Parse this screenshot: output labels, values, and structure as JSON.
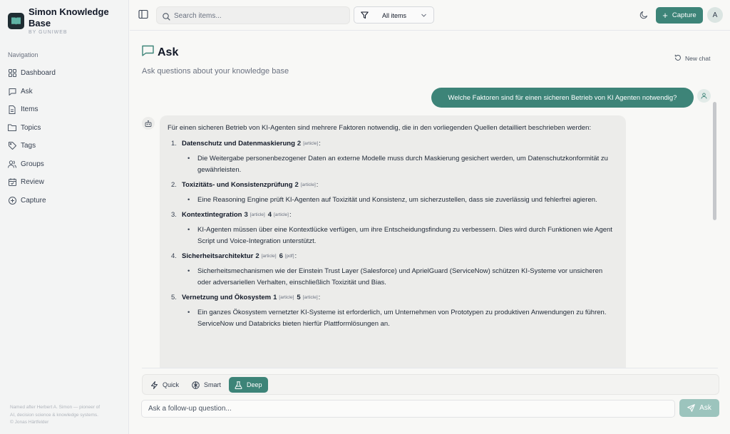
{
  "brand": {
    "title": "Simon Knowledge Base",
    "subtitle": "BY GUNIWEB"
  },
  "sidebar": {
    "heading": "Navigation",
    "items": [
      {
        "label": "Dashboard",
        "icon": "grid-icon"
      },
      {
        "label": "Ask",
        "icon": "chat-icon"
      },
      {
        "label": "Items",
        "icon": "file-icon"
      },
      {
        "label": "Topics",
        "icon": "folder-icon"
      },
      {
        "label": "Tags",
        "icon": "tag-icon"
      },
      {
        "label": "Groups",
        "icon": "users-icon"
      },
      {
        "label": "Review",
        "icon": "calendar-icon"
      },
      {
        "label": "Capture",
        "icon": "plus-circle-icon"
      }
    ],
    "footer_lines": [
      "Named after Herbert A. Simon — pioneer of",
      "AI, decision science & knowledge systems.",
      "© Jonas Härtfelder"
    ]
  },
  "topbar": {
    "search_placeholder": "Search items...",
    "filter_label": "All items",
    "capture_label": "Capture",
    "avatar_initial": "A"
  },
  "page": {
    "title": "Ask",
    "subtitle": "Ask questions about your knowledge base",
    "new_chat_label": "New chat"
  },
  "chat": {
    "user_message": "Welche Faktoren sind für einen sicheren Betrieb von KI Agenten notwendig?",
    "answer_intro": "Für einen sicheren Betrieb von KI-Agenten sind mehrere Faktoren notwendig, die in den vorliegenden Quellen detailliert beschrieben werden:",
    "points": [
      {
        "num": "1.",
        "title": "Datenschutz und Datenmaskierung",
        "refs": [
          {
            "n": "2",
            "type": "[article]"
          }
        ],
        "text": "Die Weitergabe personenbezogener Daten an externe Modelle muss durch Maskierung gesichert werden, um Datenschutzkonformität zu gewährleisten."
      },
      {
        "num": "2.",
        "title": "Toxizitäts- und Konsistenzprüfung",
        "refs": [
          {
            "n": "2",
            "type": "[article]"
          }
        ],
        "text": "Eine Reasoning Engine prüft KI-Agenten auf Toxizität und Konsistenz, um sicherzustellen, dass sie zuverlässig und fehlerfrei agieren."
      },
      {
        "num": "3.",
        "title": "Kontextintegration",
        "refs": [
          {
            "n": "3",
            "type": "[article]"
          },
          {
            "n": "4",
            "type": "[article]"
          }
        ],
        "text": "KI-Agenten müssen über eine Kontextlücke verfügen, um ihre Entscheidungsfindung zu verbessern. Dies wird durch Funktionen wie Agent Script und Voice-Integration unterstützt."
      },
      {
        "num": "4.",
        "title": "Sicherheitsarchitektur",
        "refs": [
          {
            "n": "2",
            "type": "[article]"
          },
          {
            "n": "6",
            "type": "[pdf]"
          }
        ],
        "text": "Sicherheitsmechanismen wie der Einstein Trust Layer (Salesforce) und AprielGuard (ServiceNow) schützen KI-Systeme vor unsicheren oder adversariellen Verhalten, einschließlich Toxizität und Bias."
      },
      {
        "num": "5.",
        "title": "Vernetzung und Ökosystem",
        "refs": [
          {
            "n": "1",
            "type": "[article]"
          },
          {
            "n": "5",
            "type": "[article]"
          }
        ],
        "text": "Ein ganzes Ökosystem vernetzter KI-Systeme ist erforderlich, um Unternehmen von Prototypen zu produktiven Anwendungen zu führen. ServiceNow und Databricks bieten hierfür Plattformlösungen an."
      }
    ]
  },
  "modes": {
    "quick": "Quick",
    "smart": "Smart",
    "deep": "Deep",
    "active": "Deep"
  },
  "composer": {
    "placeholder": "Ask a follow-up question...",
    "ask_label": "Ask"
  },
  "colors": {
    "accent": "#3d8478",
    "accent_disabled": "#9cc4bd"
  }
}
